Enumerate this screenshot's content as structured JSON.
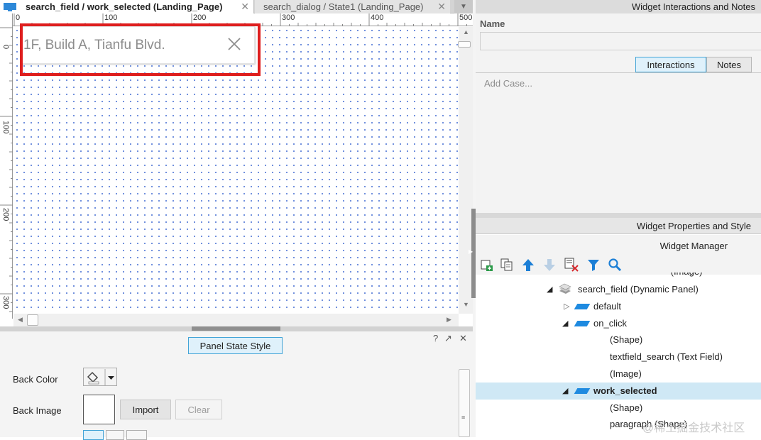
{
  "tabs": [
    {
      "label": "search_field / work_selected (Landing_Page)",
      "active": true
    },
    {
      "label": "search_dialog / State1 (Landing_Page)",
      "active": false
    }
  ],
  "ruler": {
    "h_labels": [
      "0",
      "100",
      "200",
      "300",
      "400",
      "500"
    ],
    "v_labels": [
      "0",
      "100",
      "200",
      "300"
    ]
  },
  "canvas": {
    "search_text": "1F, Build A, Tianfu Blvd.",
    "clear_icon": "close-icon",
    "selection_color": "#de1e1e"
  },
  "panel_state_style": {
    "tab_label": "Panel State Style",
    "back_color_label": "Back Color",
    "back_image_label": "Back Image",
    "import_label": "Import",
    "clear_label": "Clear"
  },
  "panel_controls": {
    "help": "?",
    "popout": "↗",
    "close": "✕"
  },
  "interactions_panel": {
    "header": "Widget Interactions and Notes",
    "name_label": "Name",
    "name_value": "",
    "tab_interactions": "Interactions",
    "tab_notes": "Notes",
    "add_case": "Add Case..."
  },
  "widget_properties": {
    "header": "Widget Properties and Style"
  },
  "widget_manager": {
    "header": "Widget Manager",
    "toolbar": [
      "add-state-icon",
      "duplicate-icon",
      "move-up-icon",
      "move-down-icon",
      "delete-icon",
      "filter-icon",
      "search-icon"
    ],
    "tree": [
      {
        "label": "search_field (Dynamic Panel)",
        "level": 0,
        "expanded": true,
        "type": "dynamic-panel"
      },
      {
        "label": "default",
        "level": 1,
        "expanded": false,
        "type": "state"
      },
      {
        "label": "on_click",
        "level": 1,
        "expanded": true,
        "type": "state"
      },
      {
        "label": "(Shape)",
        "level": 2,
        "type": "widget"
      },
      {
        "label": "textfield_search (Text Field)",
        "level": 2,
        "type": "widget"
      },
      {
        "label": "(Image)",
        "level": 2,
        "type": "widget"
      },
      {
        "label": "work_selected",
        "level": 1,
        "expanded": true,
        "type": "state",
        "selected": true
      },
      {
        "label": "(Shape)",
        "level": 2,
        "type": "widget"
      },
      {
        "label": "paragraph (Shape)",
        "level": 2,
        "type": "widget"
      }
    ]
  },
  "watermark": "@稀土掘金技术社区",
  "colors": {
    "accent": "#43a4d7",
    "tab_selected_bg": "#dff1fb",
    "tree_selected_bg": "#cfe8f5",
    "state_icon": "#1e8ae0"
  }
}
